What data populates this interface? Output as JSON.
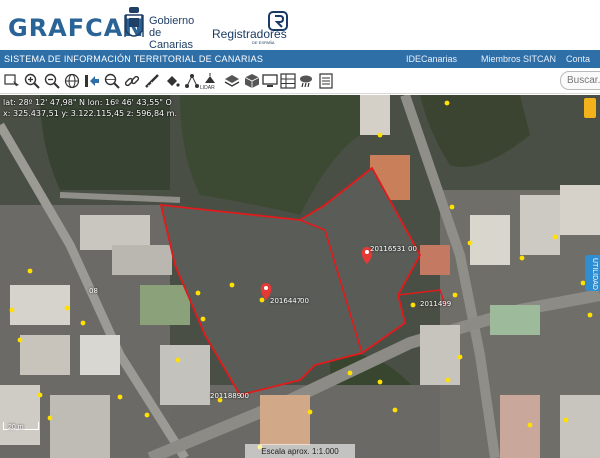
{
  "header": {
    "logo": "GRAFCAN",
    "gobierno_line1": "Gobierno",
    "gobierno_line2": "de Canarias",
    "registradores": "Registradores",
    "registradores_sub": "DE ESPAÑA"
  },
  "navbar": {
    "title": "SISTEMA DE INFORMACIÓN TERRITORIAL DE CANARIAS",
    "links": [
      "IDECanarias",
      "Miembros SITCAN",
      "Conta"
    ]
  },
  "toolbar": {
    "tools": [
      "select-icon",
      "zoom-in-icon",
      "zoom-out-icon",
      "globe-icon",
      "exit-icon",
      "search-globe-icon",
      "link-icon",
      "measure-icon",
      "fill-icon",
      "network-icon",
      "lidar-icon",
      "layers-icon",
      "cube-icon",
      "monitor-icon",
      "grid-icon",
      "weather-icon",
      "list-icon"
    ],
    "lidar_label": "LIDAR",
    "search_placeholder": "Buscar..."
  },
  "map": {
    "coords_line1": "lat: 28º 12' 47,98\" N  lon: 16º 46' 43,55\" O",
    "coords_line2": "x: 325.437,51  y: 3.122.115,45  z: 596,84 m.",
    "parcel_labels": [
      "2016447",
      "00",
      "20116531",
      "00",
      "2011889",
      "00",
      "2011499",
      "08"
    ],
    "scale_text": "Escala aprox. 1:1.000",
    "scale_bar": "20 m",
    "side_tab": "UTILIDAD"
  },
  "colors": {
    "brand_blue": "#2a6496",
    "nav_blue": "#2f6fa8",
    "parcel_red": "#e11b1b",
    "marker_red": "#e53935",
    "point_yellow": "#ffe000"
  }
}
